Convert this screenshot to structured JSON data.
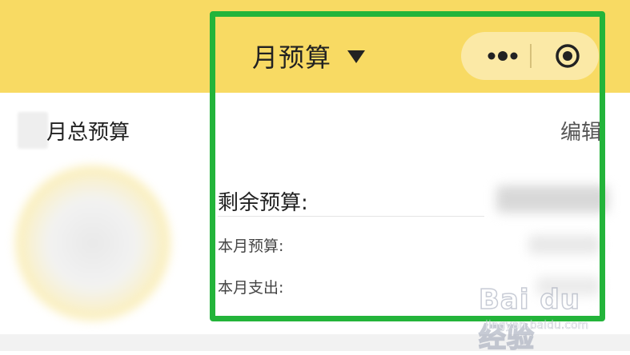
{
  "header": {
    "title": "月预算"
  },
  "summary": {
    "section_label": "月总预算",
    "edit_label": "编辑"
  },
  "details": {
    "remaining_label": "剩余预算:",
    "month_budget_label": "本月预算:",
    "month_spend_label": "本月支出:"
  },
  "icons": {
    "dropdown": "caret-down-icon",
    "more": "more-dots-icon",
    "close": "target-close-icon"
  },
  "watermark": {
    "logo": "Bai du 经验",
    "url": "jingyan.baidu.com"
  },
  "colors": {
    "header_bg": "#f8da63",
    "capsule_bg": "#fbe9a6",
    "highlight_border": "#23b43a"
  }
}
